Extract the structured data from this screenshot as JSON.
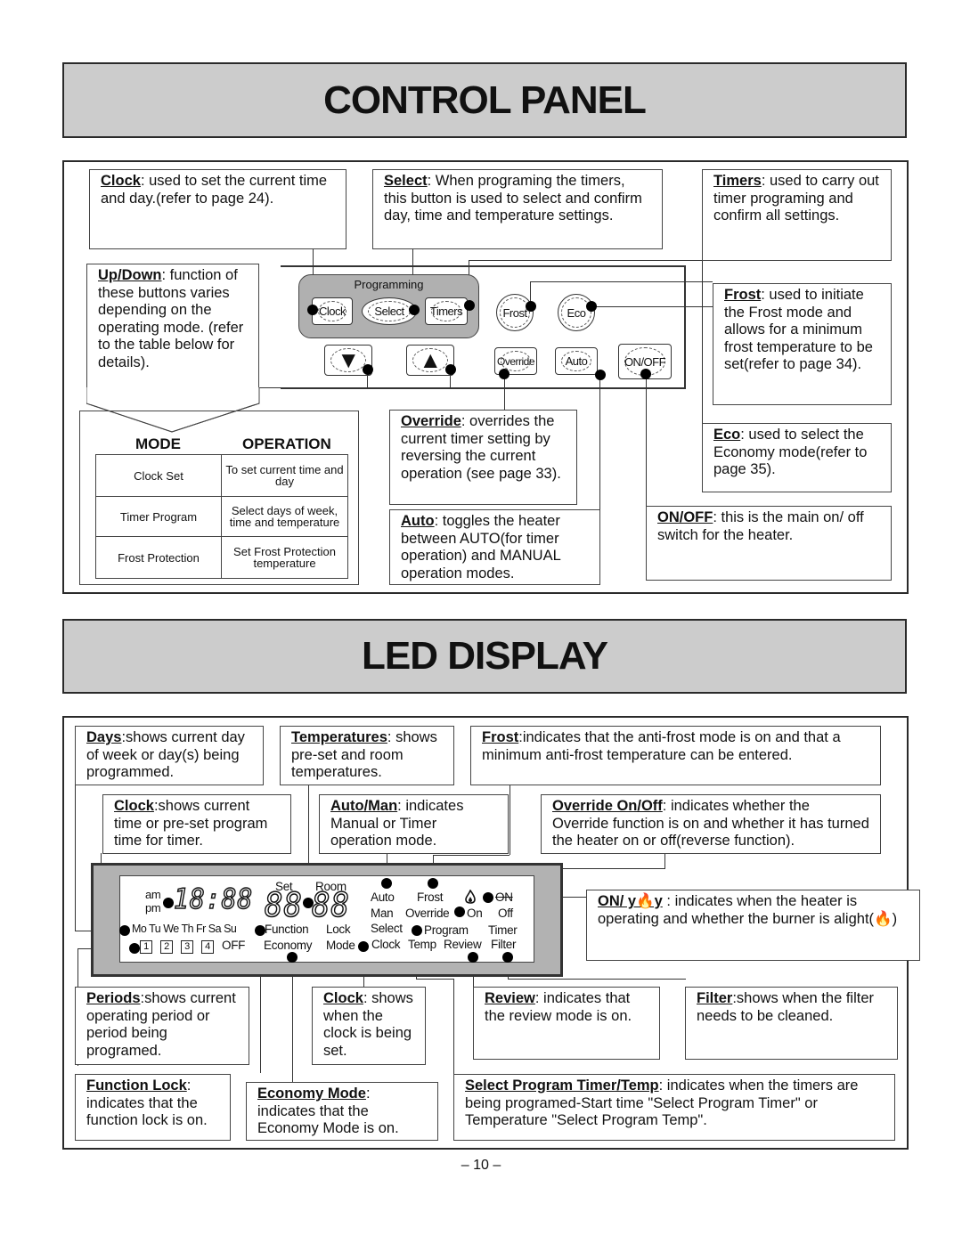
{
  "control_panel": {
    "title": "CONTROL PANEL",
    "callouts": {
      "clock": {
        "term": "Clock",
        "text": ": used to set the current time and day.(refer to page 24)."
      },
      "select": {
        "term": "Select",
        "text": ": When programing the timers, this button is used to select and confirm day, time and temperature settings."
      },
      "timers": {
        "term": "Timers",
        "text": ": used to carry out timer programing and confirm all settings."
      },
      "updown": {
        "term": "Up/Down",
        "text": ": function of these buttons varies depending on the operating mode. (refer to the table below for details)."
      },
      "frost": {
        "term": "Frost",
        "text": ": used to initiate the Frost mode and allows for a minimum frost temperature to be set(refer to page 34)."
      },
      "eco": {
        "term": "Eco",
        "text": ": used to select the Economy mode(refer to page 35)."
      },
      "override": {
        "term": "Override",
        "text": ": overrides the current timer setting by reversing the current operation (see page 33)."
      },
      "auto": {
        "term": "Auto",
        "text": ": toggles the heater between AUTO(for timer operation) and MANUAL operation modes."
      },
      "onoff": {
        "term": "ON/OFF",
        "text": ": this is the main on/ off switch for the heater."
      }
    },
    "panel": {
      "group_label": "Programming",
      "buttons": {
        "clock": "Clock",
        "select": "Select",
        "timers": "Timers",
        "frost": "Frost",
        "eco": "Eco",
        "down": "▼",
        "up": "▲",
        "override": "Override",
        "auto": "Auto",
        "onoff": "ON/OFF"
      }
    },
    "mode_table": {
      "headers": [
        "MODE",
        "OPERATION"
      ],
      "rows": [
        {
          "mode": "Clock Set",
          "operation": "To set current time and day"
        },
        {
          "mode": "Timer Program",
          "operation": "Select days of week, time and temperature"
        },
        {
          "mode": "Frost Protection",
          "operation": "Set Frost Protection temperature"
        }
      ]
    }
  },
  "led_display": {
    "title": "LED DISPLAY",
    "callouts": {
      "days": {
        "term": "Days",
        "text": ":shows current day of week or day(s) being programmed."
      },
      "temperatures": {
        "term": "Temperatures",
        "text": ": shows pre-set and room temperatures."
      },
      "frost": {
        "term": "Frost",
        "text": ":indicates that the anti-frost mode is on and that a minimum anti-frost temperature can be entered."
      },
      "clock_top": {
        "term": "Clock",
        "text": ":shows current time or pre-set program time for timer."
      },
      "automan": {
        "term": "Auto/Man",
        "text": ": indicates Manual or Timer operation mode."
      },
      "override": {
        "term": "Override On/Off",
        "text": ":  indicates whether the Override function is on and whether it has turned the heater on or off(reverse function)."
      },
      "on_flame": {
        "term": "ON/ y🔥y",
        "text": " :  indicates when the heater is operating and whether the burner is alight(🔥)"
      },
      "periods": {
        "term": "Periods",
        "text": ":shows current operating period or period being programed."
      },
      "clock_bottom": {
        "term": "Clock",
        "text": ": shows when the clock is being set."
      },
      "review": {
        "term": "Review",
        "text": ": indicates that the review mode is on."
      },
      "filter": {
        "term": "Filter",
        "text": ":shows when the filter needs to be cleaned."
      },
      "function_lock": {
        "term": "Function Lock",
        "text": ": indicates that the function lock is on."
      },
      "economy_mode": {
        "term": "Economy Mode",
        "text": ":  indicates that the Economy Mode is on."
      },
      "select_program": {
        "term": "Select Program Timer/Temp",
        "text": ": indicates when the timers are being programed-Start time \"Select Program Timer\" or Temperature \"Select Program Temp\"."
      }
    },
    "lcd": {
      "am": "am",
      "pm": "pm",
      "clock_digits": "18:88",
      "set_label": "Set",
      "room_label": "Room",
      "set_digits": "88",
      "room_digits": "88",
      "days": "Mo Tu We Th Fr Sa Su",
      "periods": [
        "1",
        "2",
        "3",
        "4"
      ],
      "off_label": "OFF",
      "function": "Function",
      "lock": "Lock",
      "economy": "Economy",
      "mode": "Mode",
      "auto": "Auto",
      "man": "Man",
      "select": "Select",
      "clock": "Clock",
      "frost": "Frost",
      "override": "Override",
      "program": "Program",
      "temp": "Temp",
      "review": "Review",
      "on_upper": "ON",
      "on": "On",
      "off": "Off",
      "timer": "Timer",
      "filter": "Filter",
      "flame_icon": "flame-icon"
    }
  },
  "page_number": "– 10 –"
}
